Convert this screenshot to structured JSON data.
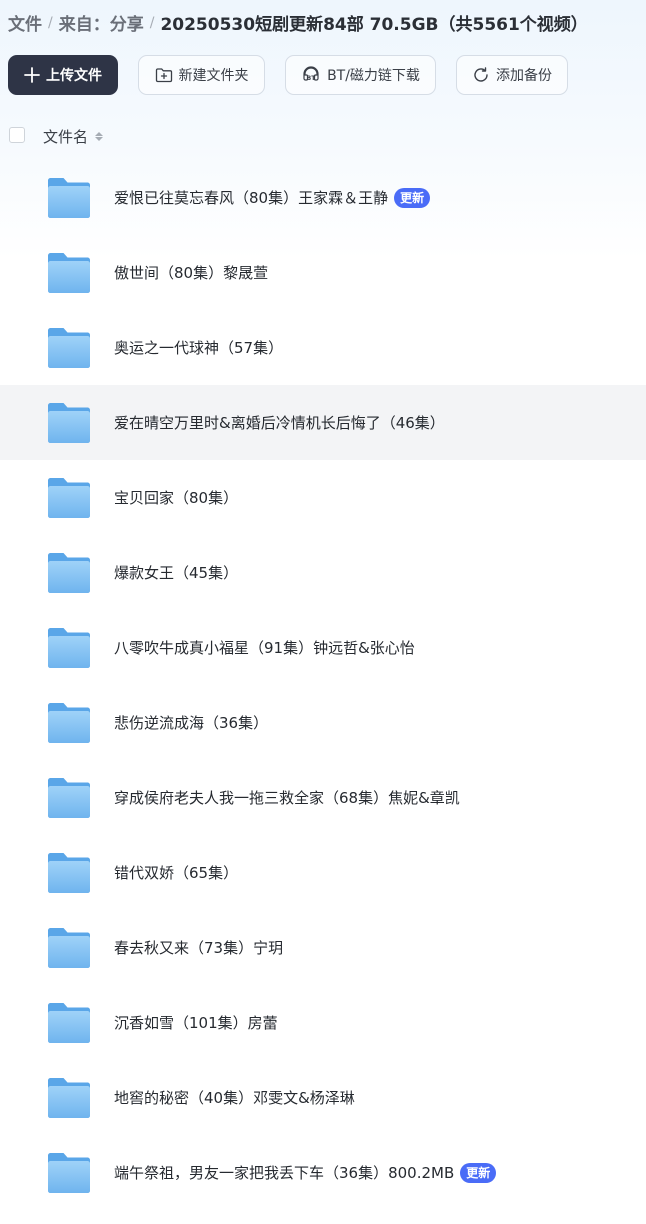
{
  "breadcrumb": {
    "items": [
      "文件",
      "来自：分享"
    ],
    "separator": "/",
    "current": "20250530短剧更新84部 70.5GB（共5561个视频）"
  },
  "toolbar": {
    "upload_label": "上传文件",
    "new_folder_label": "新建文件夹",
    "bt_label": "BT/磁力链下载",
    "backup_label": "添加备份"
  },
  "list_header": {
    "name_label": "文件名"
  },
  "files": [
    {
      "name": "爱恨已往莫忘春风（80集）王家霖＆王静",
      "badge": "更新"
    },
    {
      "name": "傲世间（80集）黎晟萱",
      "badge": ""
    },
    {
      "name": "奥运之一代球神（57集）",
      "badge": ""
    },
    {
      "name": "爱在晴空万里时&离婚后冷情机长后悔了（46集）",
      "badge": ""
    },
    {
      "name": "宝贝回家（80集）",
      "badge": ""
    },
    {
      "name": "爆款女王（45集）",
      "badge": ""
    },
    {
      "name": "八零吹牛成真小福星（91集）钟远哲&张心怡",
      "badge": ""
    },
    {
      "name": "悲伤逆流成海（36集）",
      "badge": ""
    },
    {
      "name": "穿成侯府老夫人我一拖三救全家（68集）焦妮&章凯",
      "badge": ""
    },
    {
      "name": "错代双娇（65集）",
      "badge": ""
    },
    {
      "name": "春去秋又来（73集）宁玥",
      "badge": ""
    },
    {
      "name": "沉香如雪（101集）房蕾",
      "badge": ""
    },
    {
      "name": "地窖的秘密（40集）邓雯文&杨泽琳",
      "badge": ""
    },
    {
      "name": "端午祭祖，男友一家把我丢下车（36集）800.2MB",
      "badge": "更新"
    }
  ],
  "hover_row_index": 3,
  "colors": {
    "primary_button": "#2e3446",
    "badge": "#4a6cf7",
    "folder": "#7fbff2",
    "row_hover": "#f3f4f6"
  }
}
